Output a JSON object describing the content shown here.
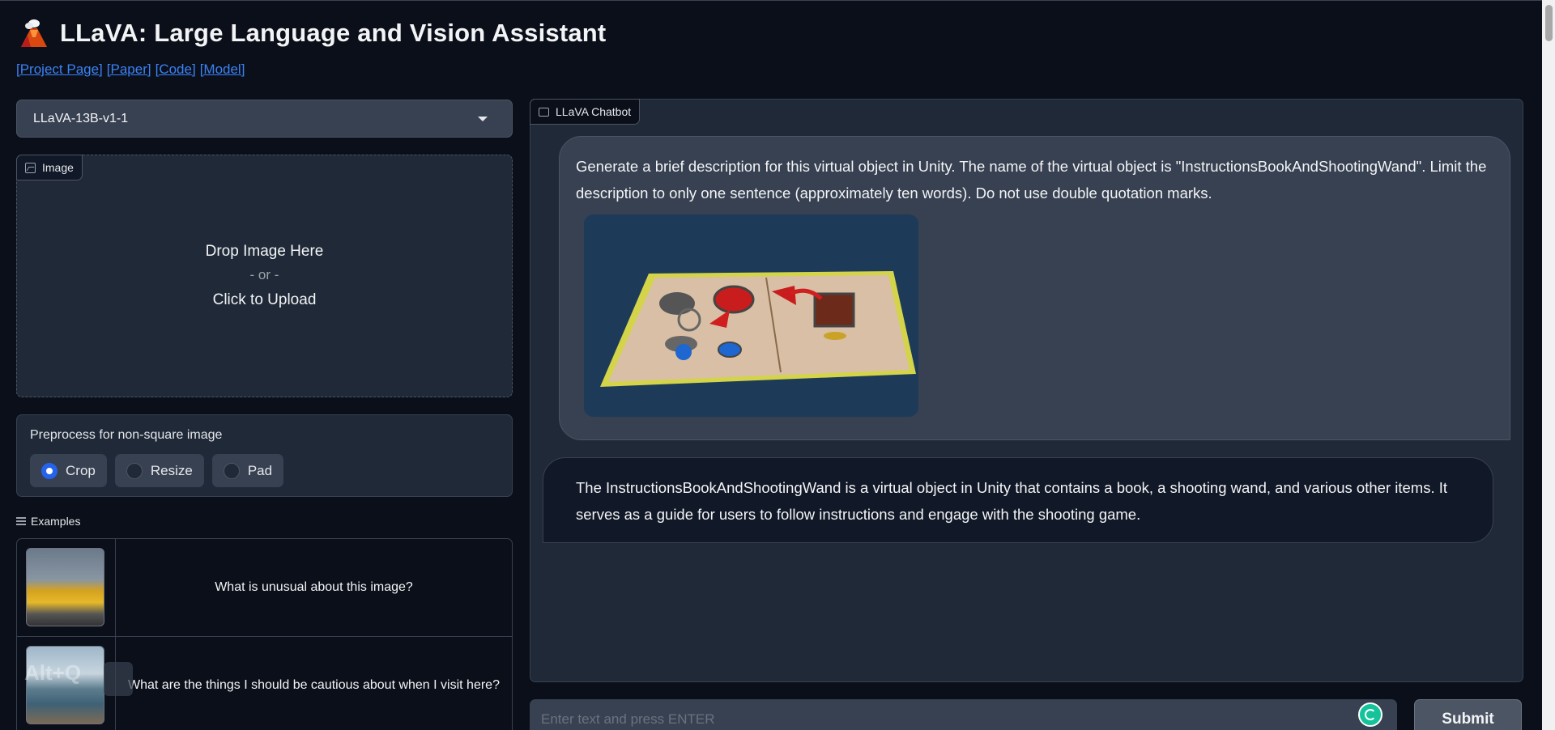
{
  "header": {
    "title": "LLaVA: Large Language and Vision Assistant",
    "links": [
      "[Project Page]",
      "[Paper]",
      "[Code]",
      "[Model]"
    ]
  },
  "model_selector": {
    "value": "LLaVA-13B-v1-1"
  },
  "image_upload": {
    "label": "Image",
    "drop_text": "Drop Image Here",
    "or_text": "- or -",
    "click_text": "Click to Upload"
  },
  "preprocess": {
    "label": "Preprocess for non-square image",
    "options": [
      "Crop",
      "Resize",
      "Pad"
    ],
    "selected": "Crop"
  },
  "examples": {
    "label": "Examples",
    "rows": [
      {
        "text": "What is unusual about this image?",
        "thumb_icon": "taxi-ironing-photo"
      },
      {
        "text": "What are the things I should be cautious about when I visit here?",
        "thumb_icon": "lake-pier-photo"
      }
    ],
    "overlay_text": "Alt+Q"
  },
  "chatbot": {
    "label": "LLaVA Chatbot",
    "messages": [
      {
        "role": "user",
        "text": "Generate a brief description for this virtual object in Unity. The name of the virtual object is \"InstructionsBookAndShootingWand\". Limit the description to only one sentence (approximately ten words). Do not use double quotation marks.",
        "image_icon": "instructions-book-render"
      },
      {
        "role": "assistant",
        "text": "The InstructionsBookAndShootingWand is a virtual object in Unity that contains a book, a shooting wand, and various other items. It serves as a guide for users to follow instructions and engage with the shooting game."
      }
    ]
  },
  "input": {
    "placeholder": "Enter text and press ENTER",
    "value": ""
  },
  "submit": {
    "label": "Submit"
  },
  "colors": {
    "background": "#0b0f19",
    "panel": "#1f2937",
    "accent": "#2563eb",
    "link": "#3b82f6"
  }
}
